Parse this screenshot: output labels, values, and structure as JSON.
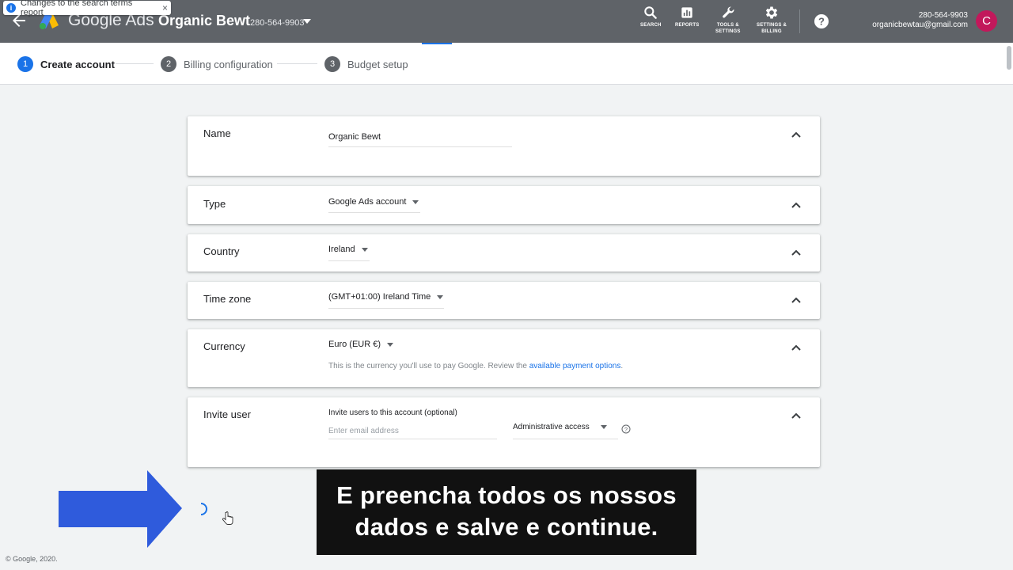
{
  "notice": {
    "text": "Changes to the search terms report",
    "close": "×"
  },
  "header": {
    "brand": "Google Ads",
    "account_name": "Organic Bewt",
    "account_id": "280-564-9903",
    "tools": [
      {
        "label": "SEARCH",
        "icon": "search-icon"
      },
      {
        "label": "REPORTS",
        "icon": "reports-icon"
      },
      {
        "label_line1": "TOOLS &",
        "label_line2": "SETTINGS",
        "icon": "wrench-icon"
      },
      {
        "label_line1": "SETTINGS &",
        "label_line2": "BILLING",
        "icon": "gear-icon"
      }
    ],
    "user_id": "280-564-9903",
    "user_email": "organicbewtau@gmail.com",
    "avatar_letter": "C"
  },
  "stepper": {
    "steps": [
      {
        "num": "1",
        "label": "Create account"
      },
      {
        "num": "2",
        "label": "Billing configuration"
      },
      {
        "num": "3",
        "label": "Budget setup"
      }
    ]
  },
  "form": {
    "name": {
      "title": "Name",
      "value": "Organic Bewt"
    },
    "type": {
      "title": "Type",
      "value": "Google Ads account"
    },
    "country": {
      "title": "Country",
      "value": "Ireland"
    },
    "timezone": {
      "title": "Time zone",
      "value": "(GMT+01:00) Ireland Time"
    },
    "currency": {
      "title": "Currency",
      "value": "Euro (EUR €)",
      "helper": "This is the currency you'll use to pay Google. Review the ",
      "helper_link": "available payment options",
      "helper_end": "."
    },
    "invite": {
      "title": "Invite user",
      "label": "Invite users to this account (optional)",
      "email_placeholder": "Enter email address",
      "access": "Administrative access"
    }
  },
  "caption": {
    "line1": "E preencha todos os nossos",
    "line2": "dados e salve e continue."
  },
  "footer": "© Google, 2020.",
  "colors": {
    "topbar": "#5f6368",
    "accent": "#1a73e8",
    "avatar": "#c2185b",
    "arrow": "#2f5bdc"
  }
}
